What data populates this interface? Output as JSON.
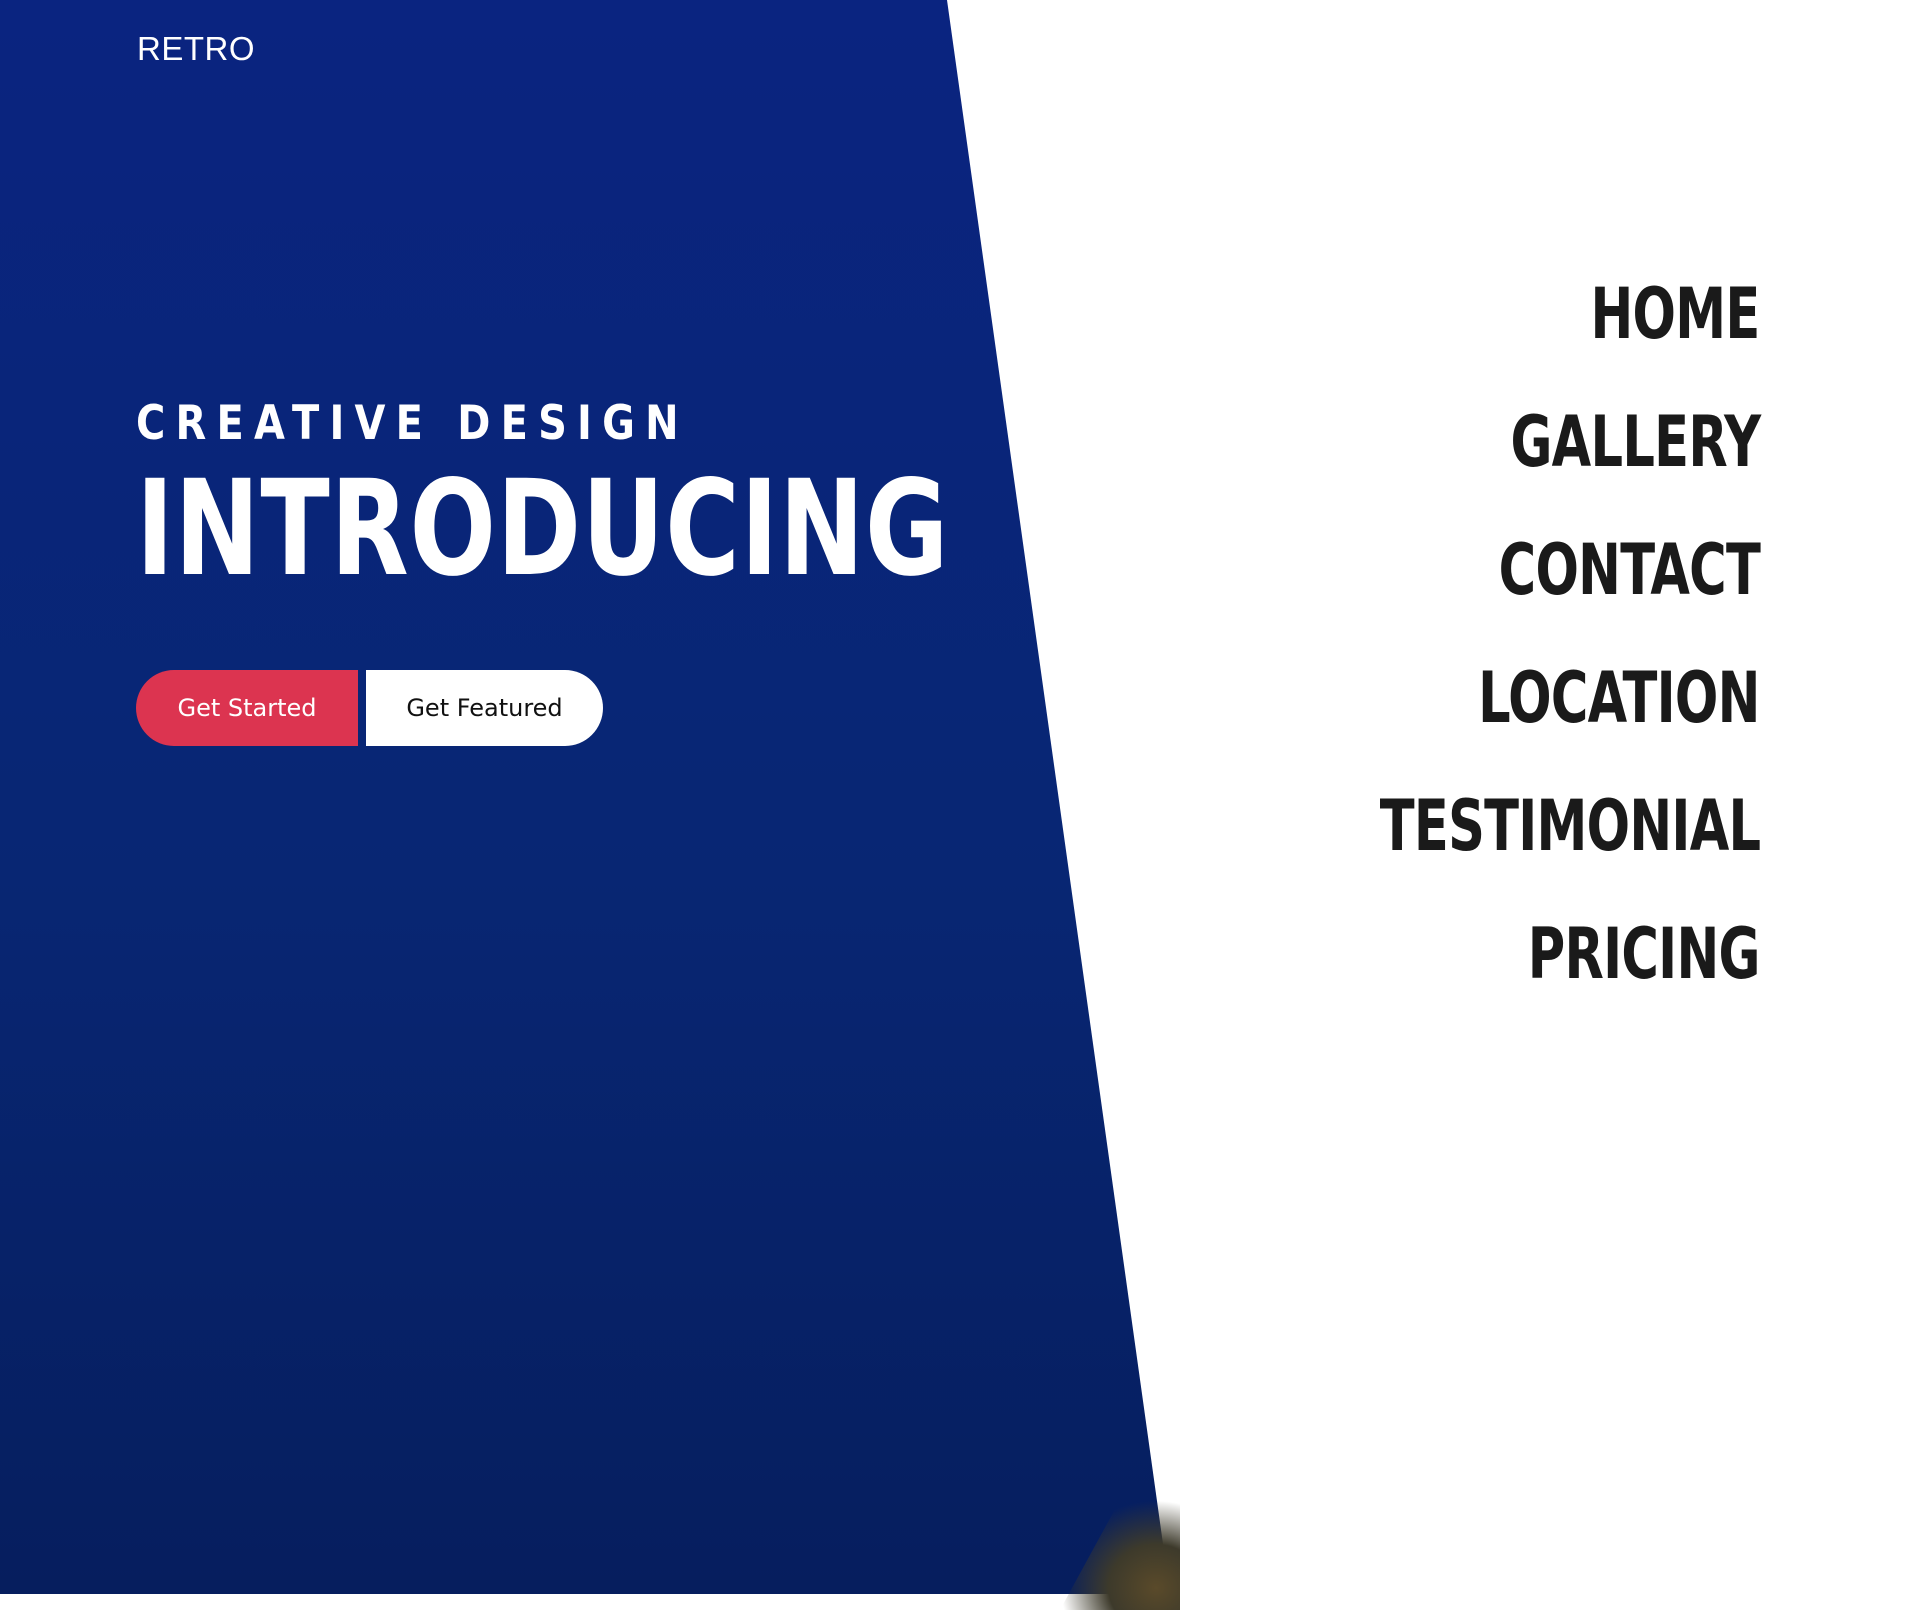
{
  "brand": {
    "name": "RETRO"
  },
  "hero": {
    "kicker": "CREATIVE DESIGN",
    "title": "INTRODUCING",
    "primary_cta": "Get Started",
    "secondary_cta": "Get Featured"
  },
  "nav": {
    "items": [
      "HOME",
      "GALLERY",
      "CONTACT",
      "LOCATION",
      "TESTIMONIAL",
      "PRICING"
    ]
  },
  "colors": {
    "hero_background": "#0a2480",
    "primary_button": "#dc3450",
    "secondary_button": "#ffffff",
    "nav_text": "#1a1a1a",
    "page_background": "#ffffff"
  }
}
